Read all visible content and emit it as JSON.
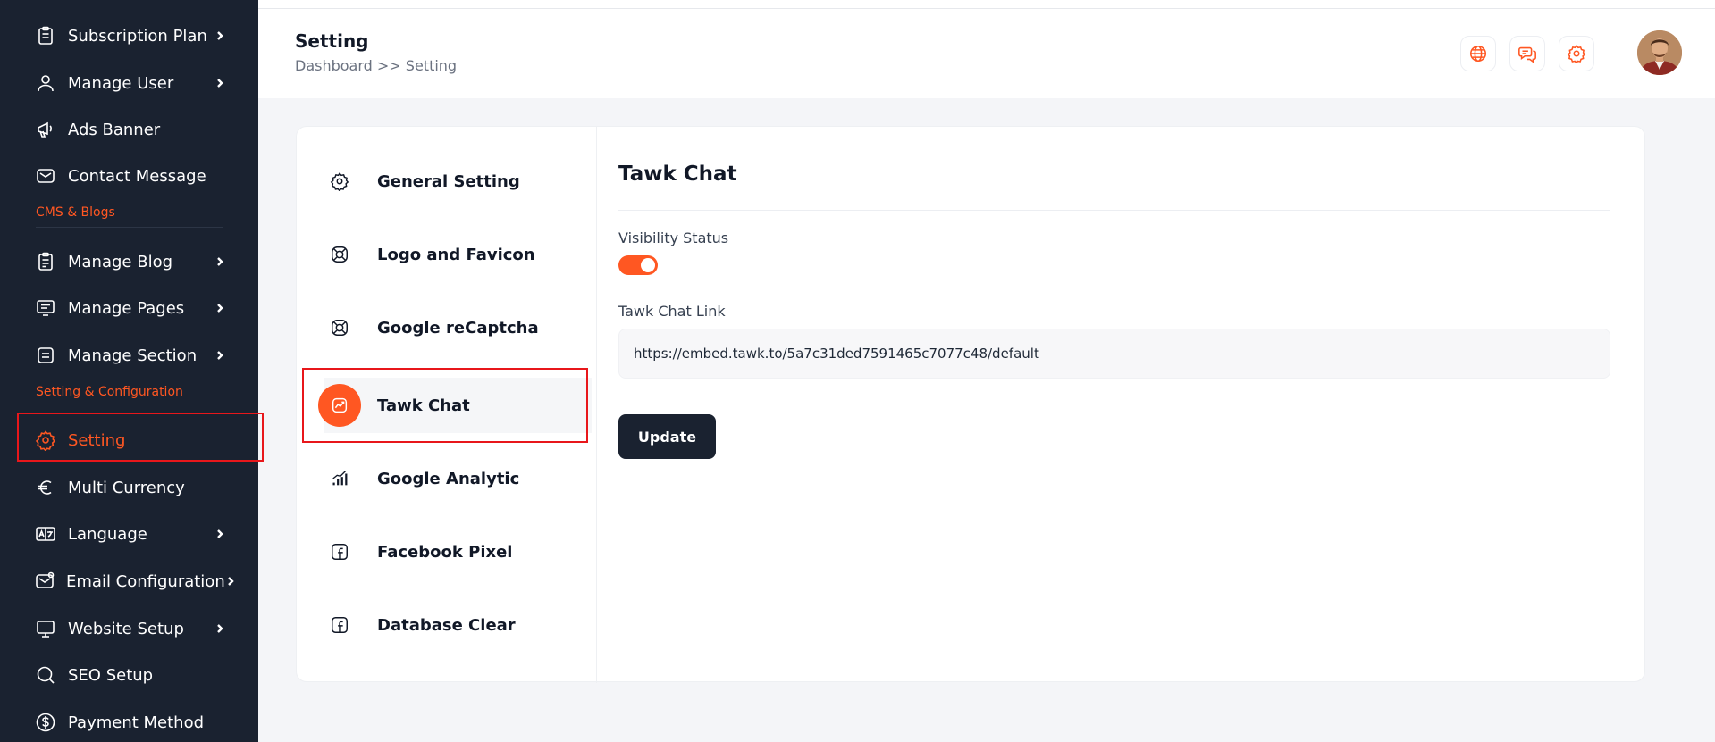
{
  "sidebar": {
    "items": [
      {
        "label": "Subscription Plan",
        "icon": "clipboard-icon"
      },
      {
        "label": "Manage User",
        "icon": "user-icon"
      },
      {
        "label": "Ads Banner",
        "icon": "megaphone-icon"
      },
      {
        "label": "Contact Message",
        "icon": "mail-icon"
      },
      {
        "label": "Manage Blog",
        "icon": "blog-icon"
      },
      {
        "label": "Manage Pages",
        "icon": "pages-icon"
      },
      {
        "label": "Manage Section",
        "icon": "section-icon"
      },
      {
        "label": "Setting",
        "icon": "gear-icon",
        "active": true
      },
      {
        "label": "Multi Currency",
        "icon": "euro-icon"
      },
      {
        "label": "Language",
        "icon": "language-icon"
      },
      {
        "label": "Email Configuration",
        "icon": "mail-config-icon"
      },
      {
        "label": "Website Setup",
        "icon": "monitor-icon"
      },
      {
        "label": "SEO Setup",
        "icon": "search-icon"
      },
      {
        "label": "Payment Method",
        "icon": "dollar-icon"
      }
    ],
    "sections": {
      "cms": "CMS & Blogs",
      "config": "Setting & Configuration"
    }
  },
  "header": {
    "title": "Setting",
    "breadcrumb": "Dashboard >> Setting",
    "icons": [
      "globe-icon",
      "chat-icon",
      "gear-icon"
    ]
  },
  "settings_tabs": [
    {
      "label": "General Setting",
      "icon": "gear-icon"
    },
    {
      "label": "Logo and Favicon",
      "icon": "lifebuoy-icon"
    },
    {
      "label": "Google reCaptcha",
      "icon": "lifebuoy-icon"
    },
    {
      "label": "Tawk Chat",
      "icon": "chart-icon",
      "active": true
    },
    {
      "label": "Google Analytic",
      "icon": "analytics-icon"
    },
    {
      "label": "Facebook Pixel",
      "icon": "facebook-icon"
    },
    {
      "label": "Database Clear",
      "icon": "facebook-icon"
    }
  ],
  "panel": {
    "title": "Tawk Chat",
    "visibility_label": "Visibility Status",
    "visibility_on": true,
    "link_label": "Tawk Chat Link",
    "link_value": "https://embed.tawk.to/5a7c31ded7591465c7077c48/default",
    "update_label": "Update"
  },
  "colors": {
    "accent": "#ff5722",
    "sidebar_bg": "#1a2230",
    "highlight": "#e8171b"
  }
}
